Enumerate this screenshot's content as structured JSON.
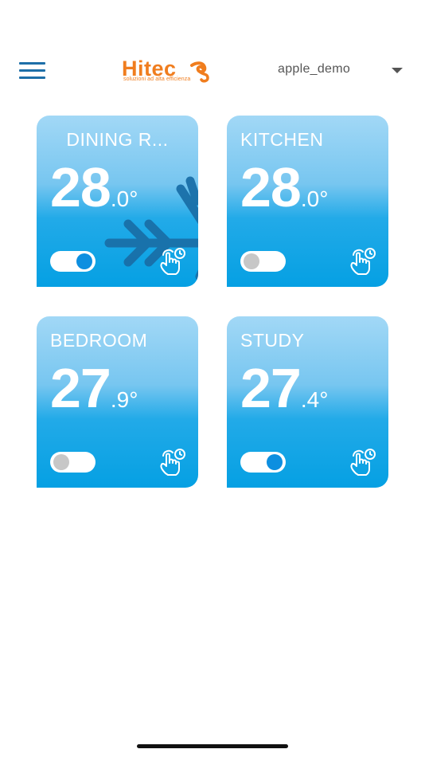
{
  "header": {
    "menu_icon": "hamburger-menu-icon",
    "logo_text": "Hitec",
    "logo_subtitle": "soluzioni ad alta efficienza",
    "user": "apple_demo",
    "user_dropdown_icon": "caret-down-icon"
  },
  "colors": {
    "brand_orange": "#f07d1e",
    "menu_blue": "#1e6fa8",
    "card_top": "#a2d8f6",
    "card_bottom": "#05a0e3",
    "toggle_on": "#0d8fe0",
    "toggle_off": "#c7c7c7",
    "snowflake": "#1a6fa8"
  },
  "zones": [
    {
      "name": "DINING R...",
      "temp_int": "28",
      "temp_dec": ".0°",
      "power_on": true,
      "cooling_icon": "snowflake-icon",
      "schedule_icon": "hand-clock-icon"
    },
    {
      "name": "KITCHEN",
      "temp_int": "28",
      "temp_dec": ".0°",
      "power_on": false,
      "schedule_icon": "hand-clock-icon"
    },
    {
      "name": "BEDROOM",
      "temp_int": "27",
      "temp_dec": ".9°",
      "power_on": false,
      "schedule_icon": "hand-clock-icon"
    },
    {
      "name": "STUDY",
      "temp_int": "27",
      "temp_dec": ".4°",
      "power_on": true,
      "schedule_icon": "hand-clock-icon"
    }
  ]
}
